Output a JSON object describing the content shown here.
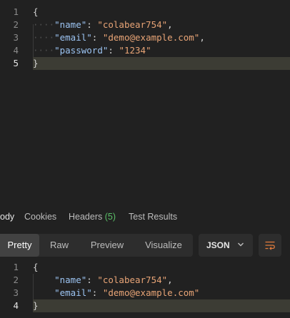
{
  "request_body": {
    "lines": [
      {
        "num": "1",
        "parts": [
          {
            "t": "{",
            "c": "punc"
          }
        ]
      },
      {
        "num": "2",
        "parts": [
          {
            "t": "····",
            "c": "ws"
          },
          {
            "t": "\"name\"",
            "c": "key"
          },
          {
            "t": ": ",
            "c": "punc"
          },
          {
            "t": "\"colabear754\"",
            "c": "str"
          },
          {
            "t": ",",
            "c": "punc"
          }
        ]
      },
      {
        "num": "3",
        "parts": [
          {
            "t": "····",
            "c": "ws"
          },
          {
            "t": "\"email\"",
            "c": "key"
          },
          {
            "t": ": ",
            "c": "punc"
          },
          {
            "t": "\"demo@example.com\"",
            "c": "str"
          },
          {
            "t": ",",
            "c": "punc"
          }
        ]
      },
      {
        "num": "4",
        "parts": [
          {
            "t": "····",
            "c": "ws"
          },
          {
            "t": "\"password\"",
            "c": "key"
          },
          {
            "t": ": ",
            "c": "punc"
          },
          {
            "t": "\"1234\"",
            "c": "str"
          }
        ]
      },
      {
        "num": "5",
        "parts": [
          {
            "t": "}",
            "c": "punc"
          }
        ],
        "active": true
      }
    ]
  },
  "response_tabs": {
    "body": "ody",
    "cookies": "Cookies",
    "headers": "Headers",
    "headers_count": "(5)",
    "test_results": "Test Results"
  },
  "toolbar": {
    "pretty": "Pretty",
    "raw": "Raw",
    "preview": "Preview",
    "visualize": "Visualize",
    "format": "JSON",
    "format_icon": "chevron-down-icon",
    "wrap_icon": "wrap-lines-icon"
  },
  "response_body": {
    "lines": [
      {
        "num": "1",
        "parts": [
          {
            "t": "{",
            "c": "punc"
          }
        ]
      },
      {
        "num": "2",
        "parts": [
          {
            "t": "    ",
            "c": "ws"
          },
          {
            "t": "\"name\"",
            "c": "key"
          },
          {
            "t": ": ",
            "c": "punc"
          },
          {
            "t": "\"colabear754\"",
            "c": "str"
          },
          {
            "t": ",",
            "c": "punc"
          }
        ]
      },
      {
        "num": "3",
        "parts": [
          {
            "t": "    ",
            "c": "ws"
          },
          {
            "t": "\"email\"",
            "c": "key"
          },
          {
            "t": ": ",
            "c": "punc"
          },
          {
            "t": "\"demo@example.com\"",
            "c": "str"
          }
        ]
      },
      {
        "num": "4",
        "parts": [
          {
            "t": "}",
            "c": "punc"
          }
        ],
        "active": true
      }
    ]
  },
  "colors": {
    "background": "#212121",
    "key": "#9cc4f2",
    "string": "#e8a476",
    "count_badge": "#5bbf68",
    "wrap_icon": "#e07b3c"
  }
}
